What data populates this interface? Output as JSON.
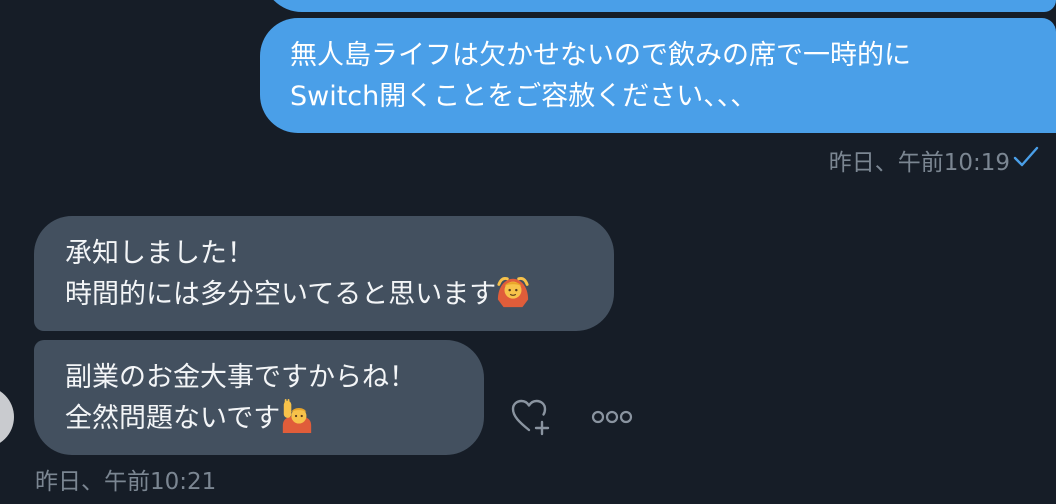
{
  "conversation": {
    "sent_messages": [
      {
        "lines": [
          "無人島ライフは欠かせないので飲みの席で一時的に",
          "Switch開くことをご容赦ください、、、"
        ],
        "timestamp": "昨日、午前10:19",
        "status_icon": "check-icon",
        "bubble_color": "#4a9fe8"
      }
    ],
    "received_messages": [
      {
        "lines": [
          "承知しました！",
          "時間的には多分空いてると思います"
        ],
        "trailing_emoji": "person-gesturing-ok-emoji"
      },
      {
        "lines": [
          "副業のお金大事ですからね！",
          "全然問題ないです"
        ],
        "trailing_emoji": "person-raising-hand-emoji"
      }
    ],
    "received_timestamp": "昨日、午前10:21",
    "received_bubble_color": "#43505f"
  },
  "actions": {
    "react_icon": "heart-plus-icon",
    "more_icon": "more-options-icon"
  }
}
